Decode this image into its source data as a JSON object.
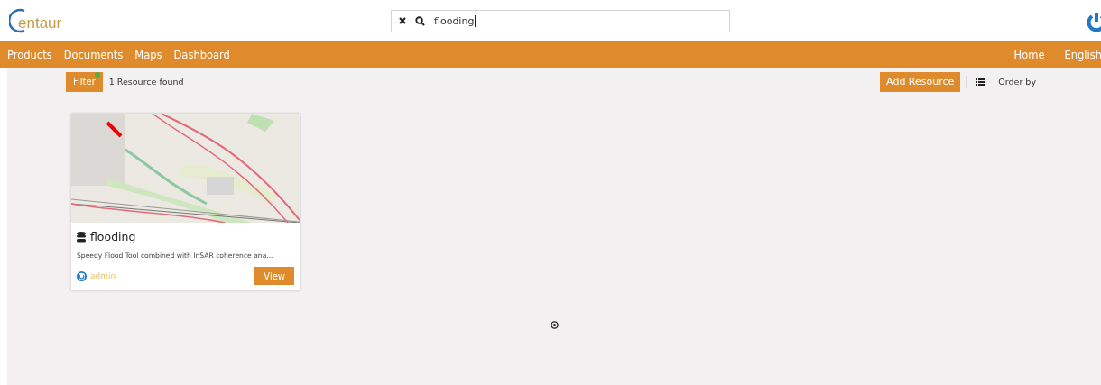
{
  "logo": {
    "text": "entaur"
  },
  "search": {
    "value": "flooding"
  },
  "nav": {
    "left": [
      "Products",
      "Documents",
      "Maps",
      "Dashboard"
    ],
    "right": [
      "Home",
      "English"
    ]
  },
  "toolbar": {
    "filter": {
      "label": "Filter",
      "active": true
    },
    "count": "1 Resource found",
    "add_button": "Add Resource",
    "order_by": "Order by"
  },
  "resources": [
    {
      "kind": "picture",
      "title": "flooding",
      "description": "Speedy Flood Tool combined with InSAR coherence ana...",
      "owner": "admin",
      "action": "View"
    }
  ]
}
